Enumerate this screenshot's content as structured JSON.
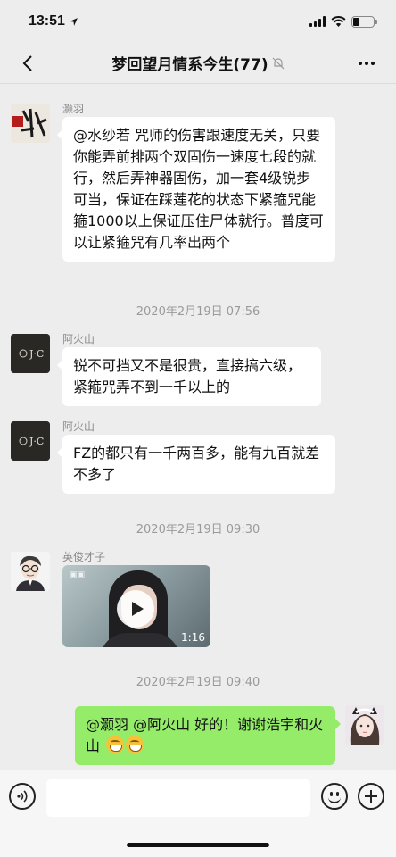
{
  "status_bar": {
    "time": "13:51",
    "battery_level_percent": 30
  },
  "chat": {
    "title": "梦回望月情系今生(77)",
    "muted_icon": "mute-bell-icon",
    "more_icon": "ellipsis-icon"
  },
  "messages": [
    {
      "sender": "灏羽",
      "avatar": "calligraphy-avatar",
      "text": "@水纱若 咒师的伤害跟速度无关，只要你能弄前排两个双固伤一速度七段的就行，然后弄神器固伤，加一套4级锐步可当，保证在踩莲花的状态下紧箍咒能箍1000以上保证压住尸体就行。普度可以让紧箍咒有几率出两个"
    },
    {
      "sender": "阿火山",
      "avatar": "jc-logo-avatar",
      "text": "锐不可挡又不是很贵，直接搞六级，紧箍咒弄不到一千以上的"
    },
    {
      "sender": "阿火山",
      "avatar": "jc-logo-avatar",
      "text": "FZ的都只有一千两百多，能有九百就差不多了"
    },
    {
      "sender": "英俊才子",
      "avatar": "cartoon-man-avatar",
      "video_duration": "1:16"
    },
    {
      "sender": "me",
      "avatar": "girl-photo-avatar",
      "text": "@灏羽 @阿火山 好的！谢谢浩宇和火山"
    }
  ],
  "timestamps": [
    "2020年2月19日 07:56",
    "2020年2月19日 09:30",
    "2020年2月19日 09:40"
  ],
  "input_bar": {
    "placeholder": "",
    "voice_icon": "voice-icon",
    "emoji_icon": "emoji-icon",
    "plus_icon": "plus-icon"
  },
  "colors": {
    "background": "#ededed",
    "self_bubble": "#95ec69",
    "other_bubble": "#ffffff",
    "meta_text": "#9a9a9a"
  }
}
